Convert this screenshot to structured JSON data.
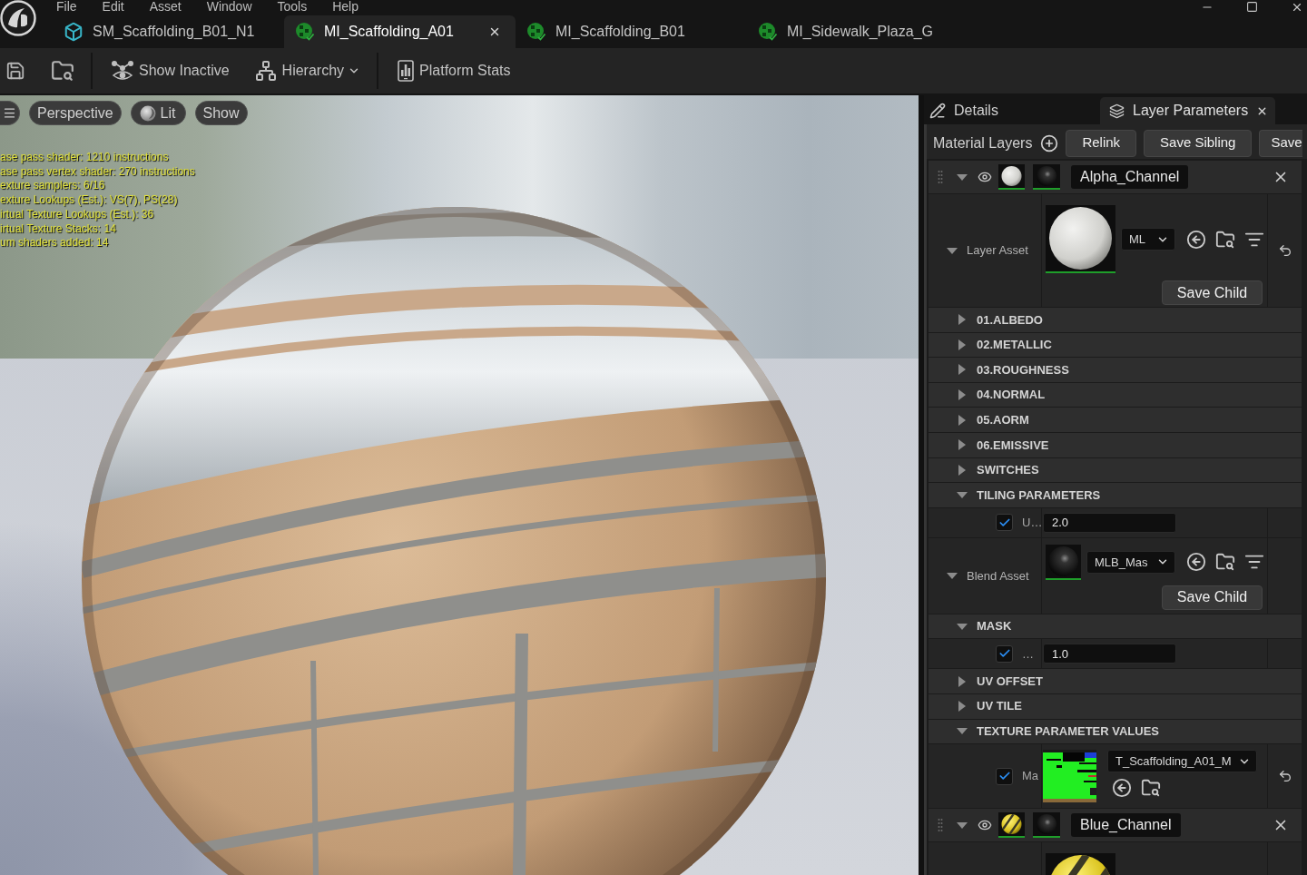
{
  "menu": [
    "File",
    "Edit",
    "Asset",
    "Window",
    "Tools",
    "Help"
  ],
  "tabs": [
    {
      "label": "SM_Scaffolding_B01_N1",
      "kind": "mesh",
      "selected": false
    },
    {
      "label": "MI_Scaffolding_A01",
      "kind": "material",
      "selected": true
    },
    {
      "label": "MI_Scaffolding_B01",
      "kind": "material",
      "selected": false
    },
    {
      "label": "MI_Sidewalk_Plaza_G",
      "kind": "material",
      "selected": false
    }
  ],
  "toolbar": {
    "groups": [
      {
        "items": [
          {
            "kind": "save"
          },
          {
            "kind": "browse"
          }
        ]
      },
      {
        "items": [
          {
            "kind": "show-inactive",
            "label": "Show Inactive",
            "dropdown": false
          },
          {
            "kind": "hierarchy",
            "label": "Hierarchy",
            "dropdown": true
          }
        ]
      },
      {
        "items": [
          {
            "kind": "stats",
            "label": "Platform Stats",
            "dropdown": false
          }
        ]
      }
    ]
  },
  "viewport": {
    "buttons": [
      {
        "kind": "menu"
      },
      {
        "kind": "text",
        "label": "Perspective"
      },
      {
        "kind": "lit",
        "label": "Lit"
      },
      {
        "kind": "text",
        "label": "Show"
      }
    ],
    "stats": [
      "ase pass shader: 1210 instructions",
      "ase pass vertex shader: 270 instructions",
      "exture samplers: 6/16",
      "exture Lookups (Est.): VS(7), PS(28)",
      "irtual Texture Lookups (Est.): 36",
      "irtual Texture Stacks: 14",
      "um shaders added: 14"
    ]
  },
  "panel": {
    "tabs": [
      {
        "label": "Details",
        "kind": "details",
        "selected": false
      },
      {
        "label": "Layer Parameters",
        "kind": "layers",
        "selected": true
      }
    ],
    "title": "Material Layers",
    "buttons": [
      "Relink",
      "Save Sibling",
      "Save"
    ],
    "layers": [
      {
        "name": "Alpha_Channel",
        "kind": "plain",
        "expanded": true,
        "visible": true,
        "rows": [
          {
            "kind": "layer-asset",
            "label": "Layer Asset",
            "expanded": true,
            "asset": "ML",
            "button": "Save Child",
            "modified": true
          },
          {
            "kind": "group",
            "label": "01.ALBEDO",
            "expanded": false
          },
          {
            "kind": "group",
            "label": "02.METALLIC",
            "expanded": false
          },
          {
            "kind": "group",
            "label": "03.ROUGHNESS",
            "expanded": false
          },
          {
            "kind": "group",
            "label": "04.NORMAL",
            "expanded": false
          },
          {
            "kind": "group",
            "label": "05.AORM",
            "expanded": false
          },
          {
            "kind": "group",
            "label": "06.EMISSIVE",
            "expanded": false
          },
          {
            "kind": "group",
            "label": "SWITCHES",
            "expanded": false
          },
          {
            "kind": "group",
            "label": "TILING PARAMETERS",
            "expanded": true,
            "children": [
              {
                "kind": "scalar",
                "label": "U…",
                "value": "2.0",
                "checked": true,
                "modified": false
              }
            ]
          },
          {
            "kind": "blend-asset",
            "label": "Blend Asset",
            "expanded": true,
            "asset": "MLB_Mas",
            "button": "Save Child",
            "modified": false
          },
          {
            "kind": "group",
            "label": "MASK",
            "expanded": true,
            "children": [
              {
                "kind": "scalar",
                "label": "…",
                "value": "1.0",
                "checked": true,
                "modified": false
              }
            ]
          },
          {
            "kind": "group",
            "label": "UV OFFSET",
            "expanded": false
          },
          {
            "kind": "group",
            "label": "UV TILE",
            "expanded": false
          },
          {
            "kind": "group",
            "label": "TEXTURE PARAMETER VALUES",
            "expanded": true,
            "children": [
              {
                "kind": "texture",
                "label": "Ma",
                "value": "T_Scaffolding_A01_M",
                "checked": true,
                "modified": true
              }
            ]
          }
        ]
      },
      {
        "name": "Blue_Channel",
        "kind": "striped",
        "expanded": true,
        "visible": true,
        "rows": [
          {
            "kind": "layer-asset"
          }
        ]
      }
    ]
  }
}
